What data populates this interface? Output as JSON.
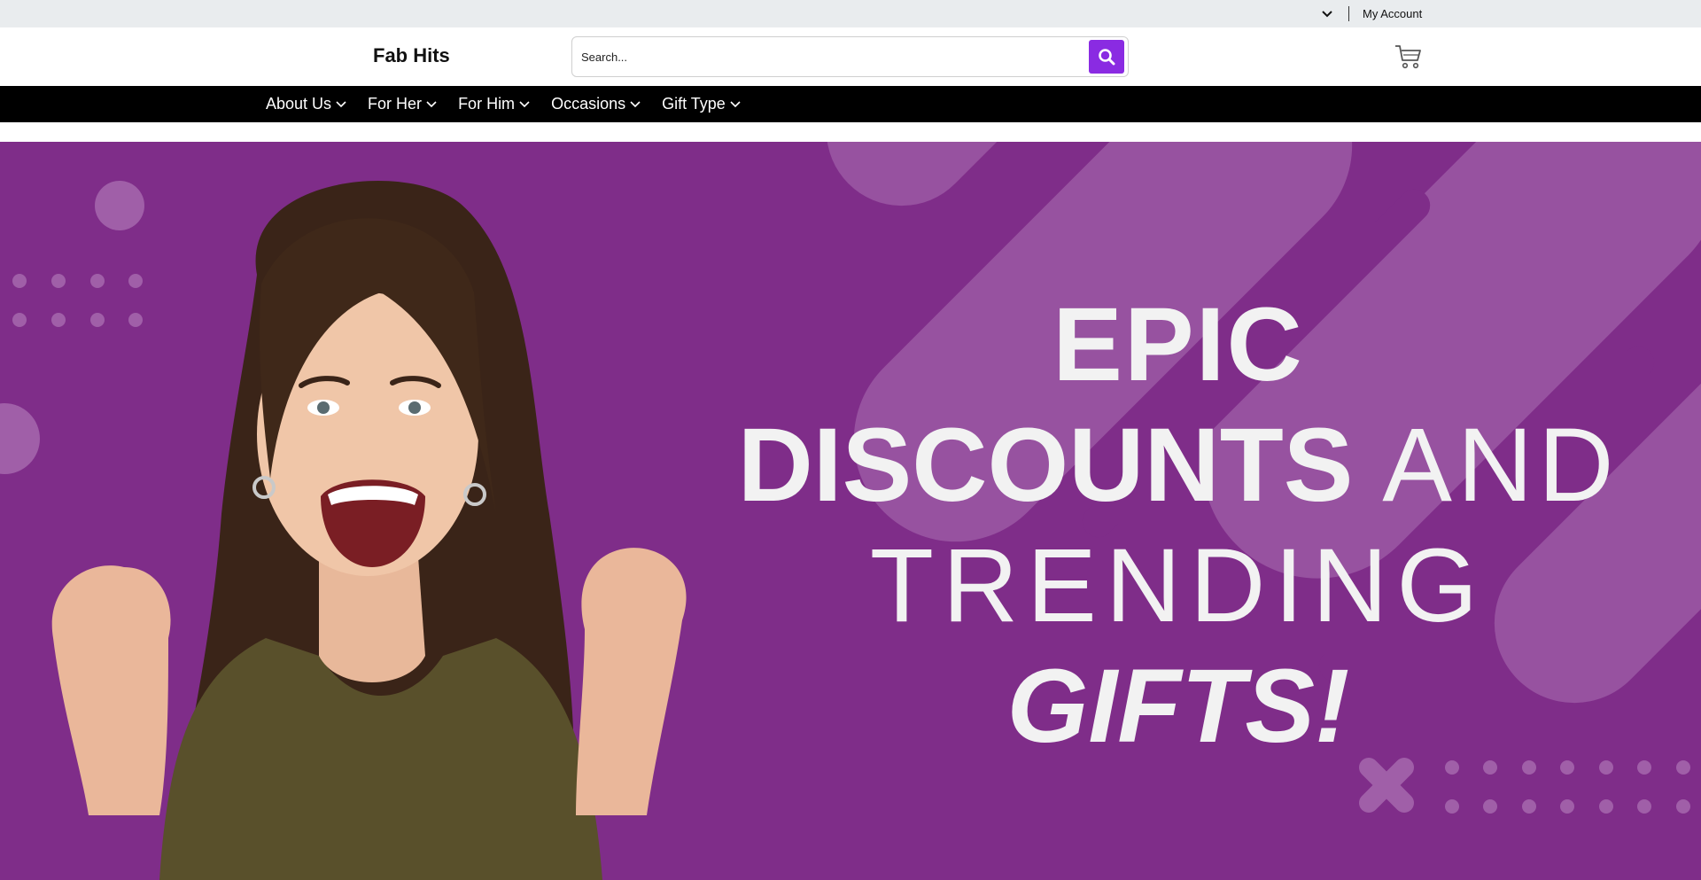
{
  "topbar": {
    "account_label": "My Account"
  },
  "header": {
    "logo": "Fab Hits",
    "search": {
      "placeholder": "Search..."
    }
  },
  "nav": {
    "items": [
      {
        "label": "About Us"
      },
      {
        "label": "For Her"
      },
      {
        "label": "For Him"
      },
      {
        "label": "Occasions"
      },
      {
        "label": "Gift Type"
      }
    ]
  },
  "hero": {
    "line1": "EPIC",
    "line2_bold": "DISCOUNTS",
    "line2_thin": "AND",
    "line3": "TRENDING",
    "line4": "GIFTS!",
    "background_color": "#7f2d89",
    "accent_color": "#a05fa8"
  },
  "colors": {
    "search_button": "#8a2be2",
    "nav_background": "#000000",
    "topbar_background": "#e9ecee"
  }
}
